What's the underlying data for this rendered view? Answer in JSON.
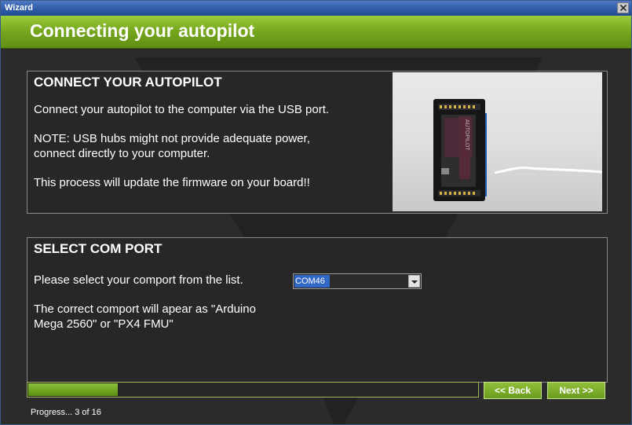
{
  "window": {
    "title": "Wizard",
    "close_icon": "close-icon"
  },
  "header": {
    "title": "Connecting your autopilot",
    "color": "#77a81e"
  },
  "connect_panel": {
    "title": "CONNECT YOUR AUTOPILOT",
    "line1": "Connect your autopilot to the computer via the USB port.",
    "note_line1": "NOTE: USB hubs might not provide adequate power,",
    "note_line2": "connect directly to your computer.",
    "line3": "This process will update the firmware on your board!!",
    "board_label": "AUTOPILOT"
  },
  "comport_panel": {
    "title": "SELECT COM PORT",
    "prompt": "Please select your comport from the list.",
    "selected_port": "COM46",
    "hint_line1": "The correct comport will apear as \"Arduino",
    "hint_line2": "Mega 2560\" or \"PX4 FMU\""
  },
  "footer": {
    "progress_fraction": 0.2,
    "progress_text": "Progress... 3 of 16",
    "back_label": "<< Back",
    "next_label": "Next >>"
  }
}
